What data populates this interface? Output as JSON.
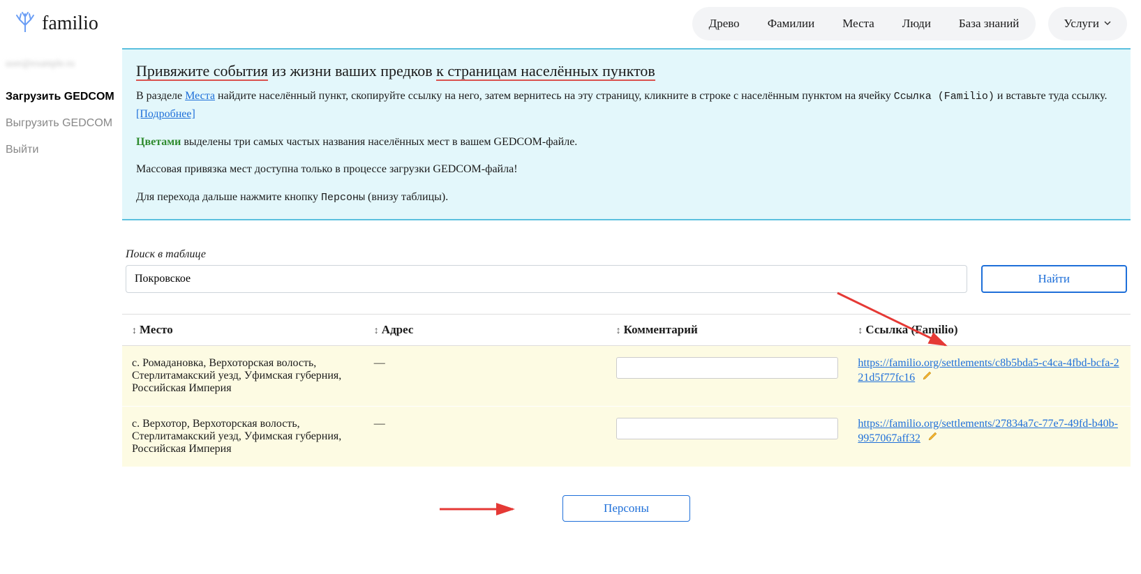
{
  "logo_text": "familio",
  "nav": {
    "items": [
      "Древо",
      "Фамилии",
      "Места",
      "Люди",
      "База знаний"
    ],
    "services": "Услуги"
  },
  "sidebar": {
    "email": "user@example.ru",
    "load": "Загрузить GEDCOM",
    "export": "Выгрузить GEDCOM",
    "logout": "Выйти"
  },
  "info": {
    "title_part1": "Привяжите события",
    "title_part2": " из жизни ваших предков ",
    "title_part3": "к страницам населённых пунктов",
    "para1_a": "В разделе ",
    "para1_link1": "Места",
    "para1_b": " найдите населённый пункт, скопируйте ссылку на него, затем вернитесь на эту страницу, кликните в строке с населённым пунктом на ячейку ",
    "para1_code": "Ссылка (Familio)",
    "para1_c": " и вставьте туда ссылку. ",
    "para1_link2": "[Подробнее]",
    "para2_green": "Цветами",
    "para2_rest": " выделены три самых частых названия населённых мест в вашем GEDCOM-файле.",
    "para3": "Массовая привязка мест доступна только в процессе загрузки GEDCOM-файла!",
    "para4_a": "Для перехода дальше нажмите кнопку ",
    "para4_code": "Персоны",
    "para4_b": " (внизу таблицы)."
  },
  "search": {
    "label": "Поиск в таблице",
    "value": "Покровское",
    "button": "Найти"
  },
  "table": {
    "headers": {
      "place": "Место",
      "address": "Адрес",
      "comment": "Комментарий",
      "link": "Ссылка (Familio)"
    },
    "rows": [
      {
        "place": "с. Ромадановка, Верхоторская волость, Стерлитамакский уезд, Уфимская губерния, Российская Империя",
        "address": "—",
        "comment": "",
        "link": "https://familio.org/settlements/c8b5bda5-c4ca-4fbd-bcfa-221d5f77fc16"
      },
      {
        "place": "с. Верхотор, Верхоторская волость, Стерлитамакский уезд, Уфимская губерния, Российская Империя",
        "address": "—",
        "comment": "",
        "link": "https://familio.org/settlements/27834a7c-77e7-49fd-b40b-9957067aff32"
      }
    ]
  },
  "persons_button": "Персоны"
}
